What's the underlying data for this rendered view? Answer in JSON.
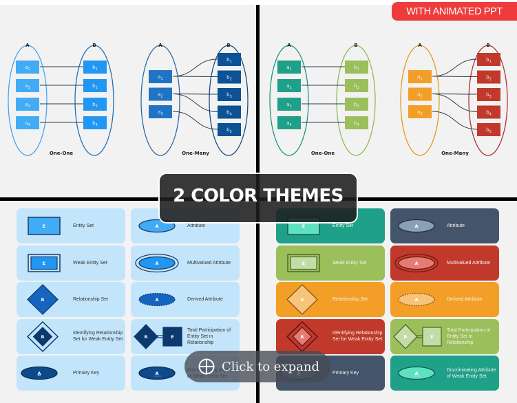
{
  "badge": {
    "label": "WITH ANIMATED PPT",
    "color": "#ee3c3c"
  },
  "banner": {
    "label": "2 COLOR THEMES"
  },
  "expand": {
    "label": "Click to expand",
    "icon": "crosshair-circle-icon"
  },
  "diagrams": {
    "set_a_label": "A",
    "set_b_label": "B",
    "one_one": {
      "caption": "One-One",
      "a_items": [
        "a1",
        "a2",
        "a3",
        "a4"
      ],
      "b_items": [
        "b1",
        "b2",
        "b3",
        "b4"
      ]
    },
    "one_many": {
      "caption": "One-Many",
      "a_items": [
        "a1",
        "a2",
        "a3"
      ],
      "b_items": [
        "b1",
        "b2",
        "b3",
        "b4",
        "b5"
      ]
    },
    "theme1_colors": {
      "one_one": {
        "ellipse_a": "#42a5f5",
        "ellipse_b": "#1e70b8",
        "box_a": "#42abf5",
        "box_b": "#2196f3"
      },
      "one_many": {
        "ellipse_a": "#2a6aa6",
        "ellipse_b": "#1a4a7e",
        "box_a": "#1f74c4",
        "box_b": "#0d5294"
      }
    },
    "theme2_colors": {
      "one_one": {
        "ellipse_a": "#1e9480",
        "ellipse_b": "#8fba54",
        "box_a": "#1fa088",
        "box_b": "#9bbf5a"
      },
      "one_many": {
        "ellipse_a": "#e39a1a",
        "ellipse_b": "#a83232",
        "box_a": "#f39f27",
        "box_b": "#c0392b"
      }
    }
  },
  "legend": {
    "items": [
      {
        "symbol": "E",
        "label": "Entity Set"
      },
      {
        "symbol": "A",
        "label": "Attribute"
      },
      {
        "symbol": "E",
        "label": "Weak Entity Set"
      },
      {
        "symbol": "A",
        "label": "Multivalued Attribute"
      },
      {
        "symbol": "R",
        "label": "Relationship Set"
      },
      {
        "symbol": "A",
        "label": "Derived Attribute"
      },
      {
        "symbol": "R",
        "label": "Identifying Relationship Set for Weak Entity Set"
      },
      {
        "symbol": "R E",
        "label": "Total Participation of Entity Set in Relationship"
      },
      {
        "symbol": "A",
        "label": "Primary Key"
      },
      {
        "symbol": "A",
        "label": "Discriminating Attribute of Weak Entity Set"
      }
    ],
    "theme2_card_colors": [
      "#1fa088",
      "#44546a",
      "#9bbf5a",
      "#c0392b",
      "#f39f27",
      "#f39f27",
      "#c0392b",
      "#9bbf5a",
      "#44546a",
      "#1fa088"
    ]
  }
}
